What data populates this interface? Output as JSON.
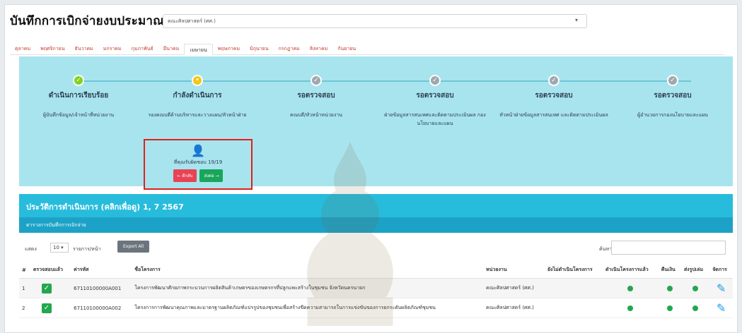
{
  "header": {
    "title": "บันทึกการเบิกจ่ายงบประมาณ"
  },
  "department_select": {
    "value": "คณะศิลปศาสตร์ (ศศ.)"
  },
  "months": [
    {
      "label": "ตุลาคม",
      "active": false
    },
    {
      "label": "พฤศจิกายน",
      "active": false
    },
    {
      "label": "ธันวาคม",
      "active": false
    },
    {
      "label": "มกราคม",
      "active": false
    },
    {
      "label": "กุมภาพันธ์",
      "active": false
    },
    {
      "label": "มีนาคม",
      "active": false
    },
    {
      "label": "เมษายน",
      "active": true
    },
    {
      "label": "พฤษภาคม",
      "active": false
    },
    {
      "label": "มิถุนายน",
      "active": false
    },
    {
      "label": "กรกฎาคม",
      "active": false
    },
    {
      "label": "สิงหาคม",
      "active": false
    },
    {
      "label": "กันยายน",
      "active": false
    }
  ],
  "workflow": {
    "steps": [
      {
        "title": "ดำเนินการเรียบร้อย",
        "desc": "ผู้บันทึกข้อมูล/เจ้าหน้าที่หน่วยงาน",
        "status": "done"
      },
      {
        "title": "กำลังดำเนินการ",
        "desc": "รองคณบดีด้านบริหารและวางแผน/หัวหน้าฝ่าย",
        "status": "current"
      },
      {
        "title": "รอตรวจสอบ",
        "desc": "คณบดี/หัวหน้าหน่วยงาน",
        "status": "pending"
      },
      {
        "title": "รอตรวจสอบ",
        "desc": "ฝ่ายข้อมูลสารสนเทศและติดตามประเมินผล กองนโยบายและแผน",
        "status": "pending"
      },
      {
        "title": "รอตรวจสอบ",
        "desc": "หัวหน้าฝ่ายข้อมูลสารสนเทศ และติดตามประเมินผล",
        "status": "pending"
      },
      {
        "title": "รอตรวจสอบ",
        "desc": "ผู้อำนวยการกองนโยบายและแผน",
        "status": "pending"
      }
    ],
    "responsible": {
      "text": "ที่คุณรับผิดชอบ 19/19",
      "back_label": "← ตีกลับ",
      "forward_label": "ส่งต่อ →"
    }
  },
  "history_bar": {
    "text": "ประวัติการดำเนินการ (คลิกเพื่อดู) 1, 7 2567"
  },
  "subtable_bar": {
    "text": "ตารางการบันทึกการเบิกจ่าย"
  },
  "controls": {
    "show_label": "แสดง",
    "page_size": "10",
    "per_page_label": "รายการ/หน้า",
    "export_label": "Export All",
    "search_label": "ค้นหา :"
  },
  "table": {
    "headers": [
      "#",
      "ตรวจสอบแล้ว",
      "ค่ารหัส",
      "ชื่อโครงการ",
      "หน่วยงาน",
      "ยังไม่ดำเนินโครงการ",
      "ดำเนินโครงการแล้ว",
      "คืนเงิน",
      "ส่งรูปเล่ม",
      "จัดการ"
    ],
    "rows": [
      {
        "no": "1",
        "code": "67110100000A001",
        "name": "โครงการพัฒนาศักยภาพกระบวนการผลิตสินค้าเกษตรของเกษตรกรที่ปลูกแพะสร้างในชุมชน จังหวัดนครนายก",
        "unit": "คณะศิลปศาสตร์ (ศศ.)"
      },
      {
        "no": "2",
        "code": "67110100000A002",
        "name": "โครงการการพัฒนาคุณภาพและมาตรฐานผลิตภัณฑ์แปรรูปของชุมชนเพื่อสร้างขีดความสามารถในการแข่งขันของการยกระดับผลิตภัณฑ์ชุมชน",
        "unit": "คณะศิลปศาสตร์ (ศศ.)"
      }
    ]
  },
  "colors": {
    "workflow_bg": "#a8e4ee",
    "history_bg": "#28bcdc",
    "highlight_border": "#e0201b",
    "ok_green": "#22a74d"
  }
}
